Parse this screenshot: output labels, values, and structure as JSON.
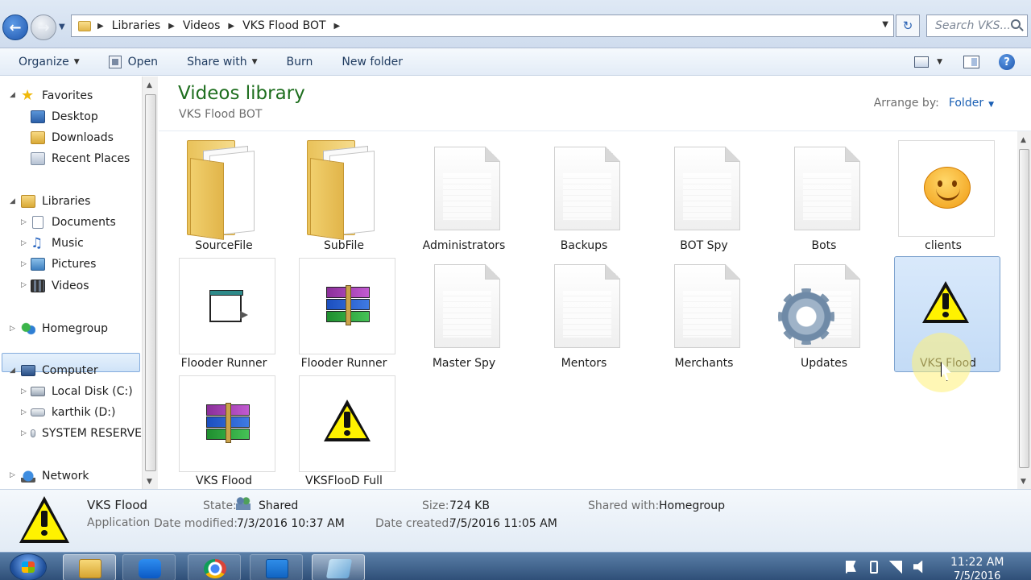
{
  "window": {
    "breadcrumb": [
      "Libraries",
      "Videos",
      "VKS Flood BOT"
    ],
    "search_placeholder": "Search VKS..."
  },
  "toolbar": {
    "organize": "Organize",
    "open": "Open",
    "share_with": "Share with",
    "burn": "Burn",
    "new_folder": "New folder"
  },
  "sidebar": {
    "favorites": {
      "label": "Favorites",
      "items": [
        {
          "label": "Desktop",
          "icon": "desktop-icon"
        },
        {
          "label": "Downloads",
          "icon": "downloads-icon"
        },
        {
          "label": "Recent Places",
          "icon": "recent-places-icon"
        }
      ]
    },
    "libraries": {
      "label": "Libraries",
      "items": [
        {
          "label": "Documents",
          "icon": "documents-icon"
        },
        {
          "label": "Music",
          "icon": "music-icon"
        },
        {
          "label": "Pictures",
          "icon": "pictures-icon"
        },
        {
          "label": "Videos",
          "icon": "videos-icon",
          "selected": true
        }
      ]
    },
    "homegroup": "Homegroup",
    "computer": {
      "label": "Computer",
      "items": [
        {
          "label": "Local Disk (C:)",
          "icon": "local-disk-icon"
        },
        {
          "label": "karthik (D:)",
          "icon": "drive-icon"
        },
        {
          "label": "SYSTEM RESERVE",
          "icon": "drive-icon"
        }
      ]
    },
    "network": "Network"
  },
  "library": {
    "title": "Videos library",
    "subtitle": "VKS Flood BOT",
    "arrange_label": "Arrange by:",
    "arrange_value": "Folder"
  },
  "items": [
    {
      "name": "SourceFile",
      "icon": "folder-icon"
    },
    {
      "name": "SubFile",
      "icon": "folder-icon"
    },
    {
      "name": "Administrators",
      "icon": "blank-file-icon"
    },
    {
      "name": "Backups",
      "icon": "blank-file-icon"
    },
    {
      "name": "BOT Spy",
      "icon": "blank-file-icon"
    },
    {
      "name": "Bots",
      "icon": "blank-file-icon"
    },
    {
      "name": "clients",
      "icon": "smiley-icon"
    },
    {
      "name": "Flooder Runner",
      "icon": "application-window-icon"
    },
    {
      "name": "Flooder Runner",
      "icon": "winrar-archive-icon"
    },
    {
      "name": "Master Spy",
      "icon": "blank-file-icon"
    },
    {
      "name": "Mentors",
      "icon": "blank-file-icon"
    },
    {
      "name": "Merchants",
      "icon": "blank-file-icon"
    },
    {
      "name": "Updates",
      "icon": "gear-icon"
    },
    {
      "name": "VKS Flood",
      "icon": "warning-icon",
      "selected": true
    },
    {
      "name": "VKS Flood",
      "icon": "winrar-archive-icon"
    },
    {
      "name": "VKSFlooD Full",
      "icon": "warning-icon"
    }
  ],
  "details": {
    "name": "VKS Flood",
    "type": "Application",
    "state_label": "State:",
    "state_value": "Shared",
    "size_label": "Size:",
    "size_value": "724 KB",
    "shared_with_label": "Shared with:",
    "shared_with_value": "Homegroup",
    "modified_label": "Date modified:",
    "modified_value": "7/3/2016 10:37 AM",
    "created_label": "Date created:",
    "created_value": "7/5/2016 11:05 AM"
  },
  "taskbar": {
    "apps": [
      "explorer-icon",
      "teamviewer-icon",
      "chrome-icon",
      "capture-icon",
      "app-icon"
    ],
    "time": "11:22 AM",
    "date": "7/5/2016"
  }
}
